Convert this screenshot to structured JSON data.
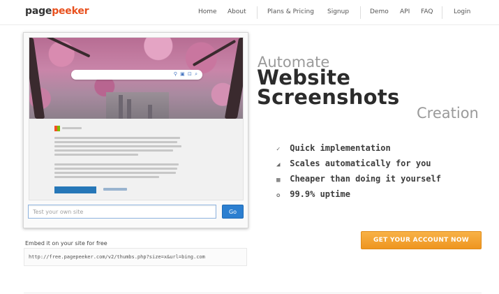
{
  "header": {
    "logo_part1": "page",
    "logo_part2": "peeker",
    "nav": {
      "home": "Home",
      "about": "About",
      "plans": "Plans & Pricing",
      "signup": "Signup",
      "demo": "Demo",
      "api": "API",
      "faq": "FAQ",
      "login": "Login"
    }
  },
  "preview": {
    "input_placeholder": "Test your own site",
    "go_label": "Go"
  },
  "embed": {
    "label": "Embed it on your site for free",
    "code": "http://free.pagepeeker.com/v2/thumbs.php?size=x&url=bing.com"
  },
  "hero": {
    "automate": "Automate",
    "website": "Website",
    "screenshots": "Screenshots",
    "creation": "Creation"
  },
  "features": [
    {
      "icon": "pencil-icon",
      "glyph": "✓",
      "text": "Quick implementation"
    },
    {
      "icon": "chart-icon",
      "glyph": "◢",
      "text": "Scales automatically for you"
    },
    {
      "icon": "grid-icon",
      "glyph": "▦",
      "text": "Cheaper than doing it yourself"
    },
    {
      "icon": "gear-icon",
      "glyph": "✪",
      "text": "99.9% uptime"
    }
  ],
  "cta_label": "GET YOUR ACCOUNT NOW",
  "colors": {
    "brand_orange": "#e8501d",
    "cta_orange": "#f0a030",
    "go_blue": "#2c7fd0"
  }
}
